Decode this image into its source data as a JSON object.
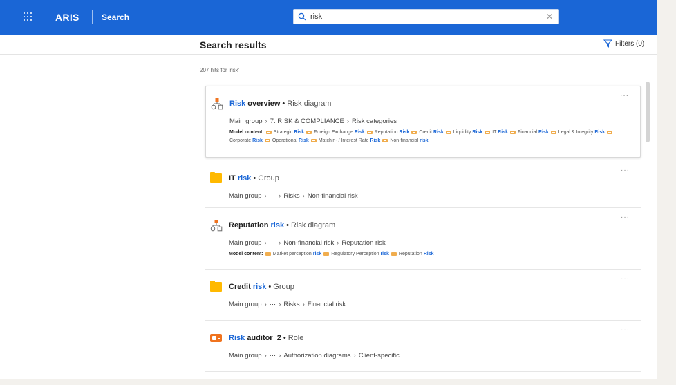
{
  "header": {
    "brand": "ARIS",
    "app": "Search",
    "search_value": "risk",
    "clear_label": "✕"
  },
  "page": {
    "title": "Search results",
    "filters_label": "Filters (0)",
    "hits_label": "207 hits for 'risk'"
  },
  "results": [
    {
      "icon": "risk-diagram-icon",
      "title_hl": "Risk",
      "title_rest": "overview",
      "type": "Risk diagram",
      "path": [
        "Main group",
        "7. RISK & COMPLIANCE",
        "Risk categories"
      ],
      "content_label": "Model content:",
      "content": [
        [
          "Strategic ",
          "Risk"
        ],
        [
          "Foreign Exchange ",
          "Risk"
        ],
        [
          "Reputation ",
          "Risk"
        ],
        [
          "Credit ",
          "Risk"
        ],
        [
          "Liquidity ",
          "Risk"
        ],
        [
          "IT ",
          "Risk"
        ],
        [
          "Financial ",
          "Risk"
        ],
        [
          "Legal & Integrity ",
          "Risk"
        ],
        [
          "Corporate ",
          "Risk"
        ],
        [
          "Operational ",
          "Risk"
        ],
        [
          "Matchin- / Interest Rate ",
          "Risk"
        ],
        [
          "Non-financial ",
          "risk"
        ]
      ]
    },
    {
      "icon": "folder-icon",
      "title_pre": "IT",
      "title_hl": "risk",
      "type": "Group",
      "path": [
        "Main group",
        "···",
        "Risks",
        "Non-financial risk"
      ]
    },
    {
      "icon": "risk-diagram-icon",
      "title_pre": "Reputation",
      "title_hl": "risk",
      "type": "Risk diagram",
      "path": [
        "Main group",
        "···",
        "Non-financial risk",
        "Reputation risk"
      ],
      "content_label": "Model content:",
      "content": [
        [
          "Market perception ",
          "risk"
        ],
        [
          "Regulatory Perception ",
          "risk"
        ],
        [
          "Reputation ",
          "Risk"
        ]
      ]
    },
    {
      "icon": "folder-icon",
      "title_pre": "Credit",
      "title_hl": "risk",
      "type": "Group",
      "path": [
        "Main group",
        "···",
        "Risks",
        "Financial risk"
      ]
    },
    {
      "icon": "role-icon",
      "title_hl": "Risk",
      "title_rest": "auditor_2",
      "type": "Role",
      "path": [
        "Main group",
        "···",
        "Authorization diagrams",
        "Client-specific"
      ]
    }
  ],
  "more_label": "···",
  "dot": "•"
}
